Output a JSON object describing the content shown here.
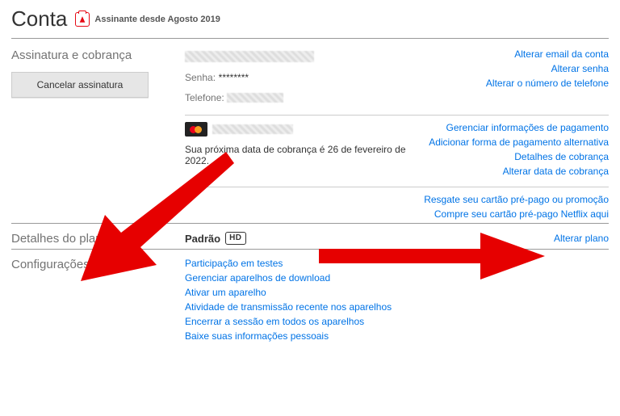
{
  "header": {
    "title": "Conta",
    "member_since": "Assinante desde Agosto 2019"
  },
  "subscription": {
    "section_title": "Assinatura e cobrança",
    "cancel_button": "Cancelar assinatura",
    "password_label": "Senha:",
    "password_value": "********",
    "phone_label": "Telefone:",
    "next_billing": "Sua próxima data de cobrança é 26 de fevereiro de 2022.",
    "links": {
      "change_email": "Alterar email da conta",
      "change_password": "Alterar senha",
      "change_phone": "Alterar o número de telefone",
      "manage_payment": "Gerenciar informações de pagamento",
      "add_payment": "Adicionar forma de pagamento alternativa",
      "billing_details": "Detalhes de cobrança",
      "change_billing_date": "Alterar data de cobrança",
      "redeem_card": "Resgate seu cartão pré-pago ou promoção",
      "buy_card": "Compre seu cartão pré-pago Netflix aqui"
    }
  },
  "plan": {
    "section_title": "Detalhes do plano",
    "plan_name": "Padrão",
    "plan_badge": "HD",
    "change_plan": "Alterar plano"
  },
  "settings": {
    "section_title": "Configurações",
    "links": {
      "test_participation": "Participação em testes",
      "manage_download_devices": "Gerenciar aparelhos de download",
      "activate_device": "Ativar um aparelho",
      "recent_activity": "Atividade de transmissão recente nos aparelhos",
      "sign_out_all": "Encerrar a sessão em todos os aparelhos",
      "download_info": "Baixe suas informações pessoais"
    }
  }
}
